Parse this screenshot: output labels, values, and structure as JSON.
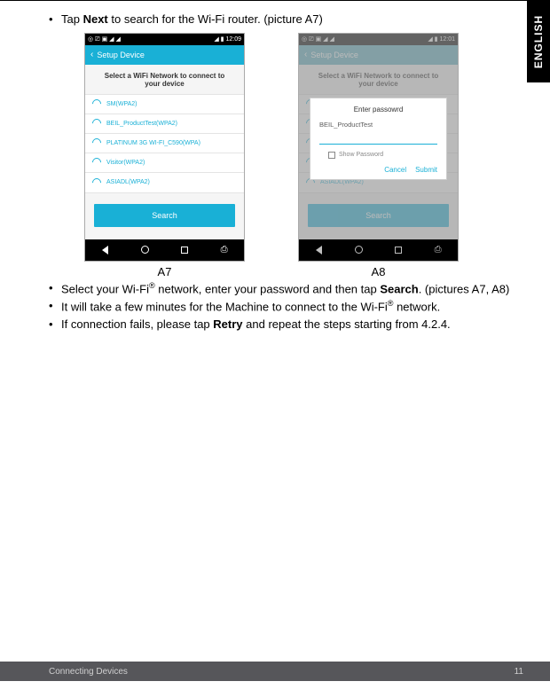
{
  "lang_tab": "ENGLISH",
  "bullets": {
    "b1_pre": "Tap ",
    "b1_bold": "Next",
    "b1_post": " to search for the Wi-Fi router. (picture A7)",
    "b2_pre": "Select your Wi-Fi",
    "b2_sup": "®",
    "b2_mid": " network, enter your password and then tap ",
    "b2_bold": "Search",
    "b2_post": ". (pictures A7, A8)",
    "b3_pre": "It will take a few minutes for the Machine to connect to the Wi-Fi",
    "b3_sup": "®",
    "b3_post": " network.",
    "b4_pre": "If connection fails, please tap ",
    "b4_bold": "Retry",
    "b4_post": " and repeat the steps starting from 4.2.4."
  },
  "labels": {
    "a7": "A7",
    "a8": "A8"
  },
  "phone": {
    "status_left": "◎ ⎚ ▣ ◢ ◢",
    "status_right_a7": "◢ ▮ 12:09",
    "status_right_a8": "◢ ▮ 12:01",
    "appbar_title": "Setup Device",
    "heading": "Select a WiFi Network to connect to your device",
    "wifi": [
      "SM(WPA2)",
      "BEIL_ProductTest(WPA2)",
      "PLATINUM 3G WI-FI_C590(WPA)",
      "Visitor(WPA2)",
      "ASIADL(WPA2)"
    ],
    "search_btn": "Search"
  },
  "dialog": {
    "title": "Enter passowrd",
    "ssid": "BEIL_ProductTest",
    "show_pw": "Show Password",
    "cancel": "Cancel",
    "submit": "Submit"
  },
  "footer": {
    "section": "Connecting Devices",
    "page": "11"
  }
}
